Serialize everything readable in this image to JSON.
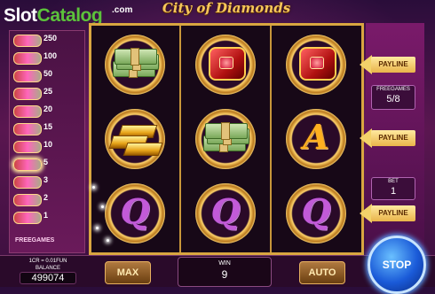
{
  "header": {
    "logo_slot": "Slot",
    "logo_catalog": "Catalog",
    "logo_com": ".com",
    "game_title": "City of Diamonds"
  },
  "paytable": {
    "items": [
      {
        "value": "250",
        "symbol": "diamond-ring-icon"
      },
      {
        "value": "100",
        "symbol": "money-icon"
      },
      {
        "value": "50",
        "symbol": "gold-icon"
      },
      {
        "value": "25",
        "symbol": "ring-icon"
      },
      {
        "value": "20",
        "symbol": "car-icon"
      },
      {
        "value": "15",
        "symbol": "chips-icon"
      },
      {
        "value": "10",
        "symbol": "cards-icon"
      },
      {
        "value": "5",
        "symbol": "a-icon"
      },
      {
        "value": "3",
        "symbol": "k-icon"
      },
      {
        "value": "2",
        "symbol": "q-icon"
      },
      {
        "value": "1",
        "symbol": "j-icon"
      }
    ],
    "active_index": 7,
    "freegames_label": "FREEGAMES"
  },
  "reels": [
    [
      "money",
      "gold",
      "q"
    ],
    [
      "ring",
      "money",
      "q"
    ],
    [
      "ring",
      "a",
      "q"
    ]
  ],
  "letters": {
    "a": "A",
    "q": "Q"
  },
  "side": {
    "payline_label": "PAYLINE",
    "freegames_label": "FREEGAMES",
    "freegames_value": "5/8",
    "bet_label": "BET",
    "bet_value": "1"
  },
  "bottom": {
    "rate": "1CR = 0.01FUN",
    "balance_label": "BALANCE",
    "balance_value": "499074",
    "max_label": "MAX",
    "win_label": "WIN",
    "win_value": "9",
    "auto_label": "AUTO",
    "stop_label": "STOP"
  },
  "colors": {
    "frame_gold": "#d9a640",
    "background": "#5a1650",
    "stop_blue": "#1a5ad8"
  }
}
